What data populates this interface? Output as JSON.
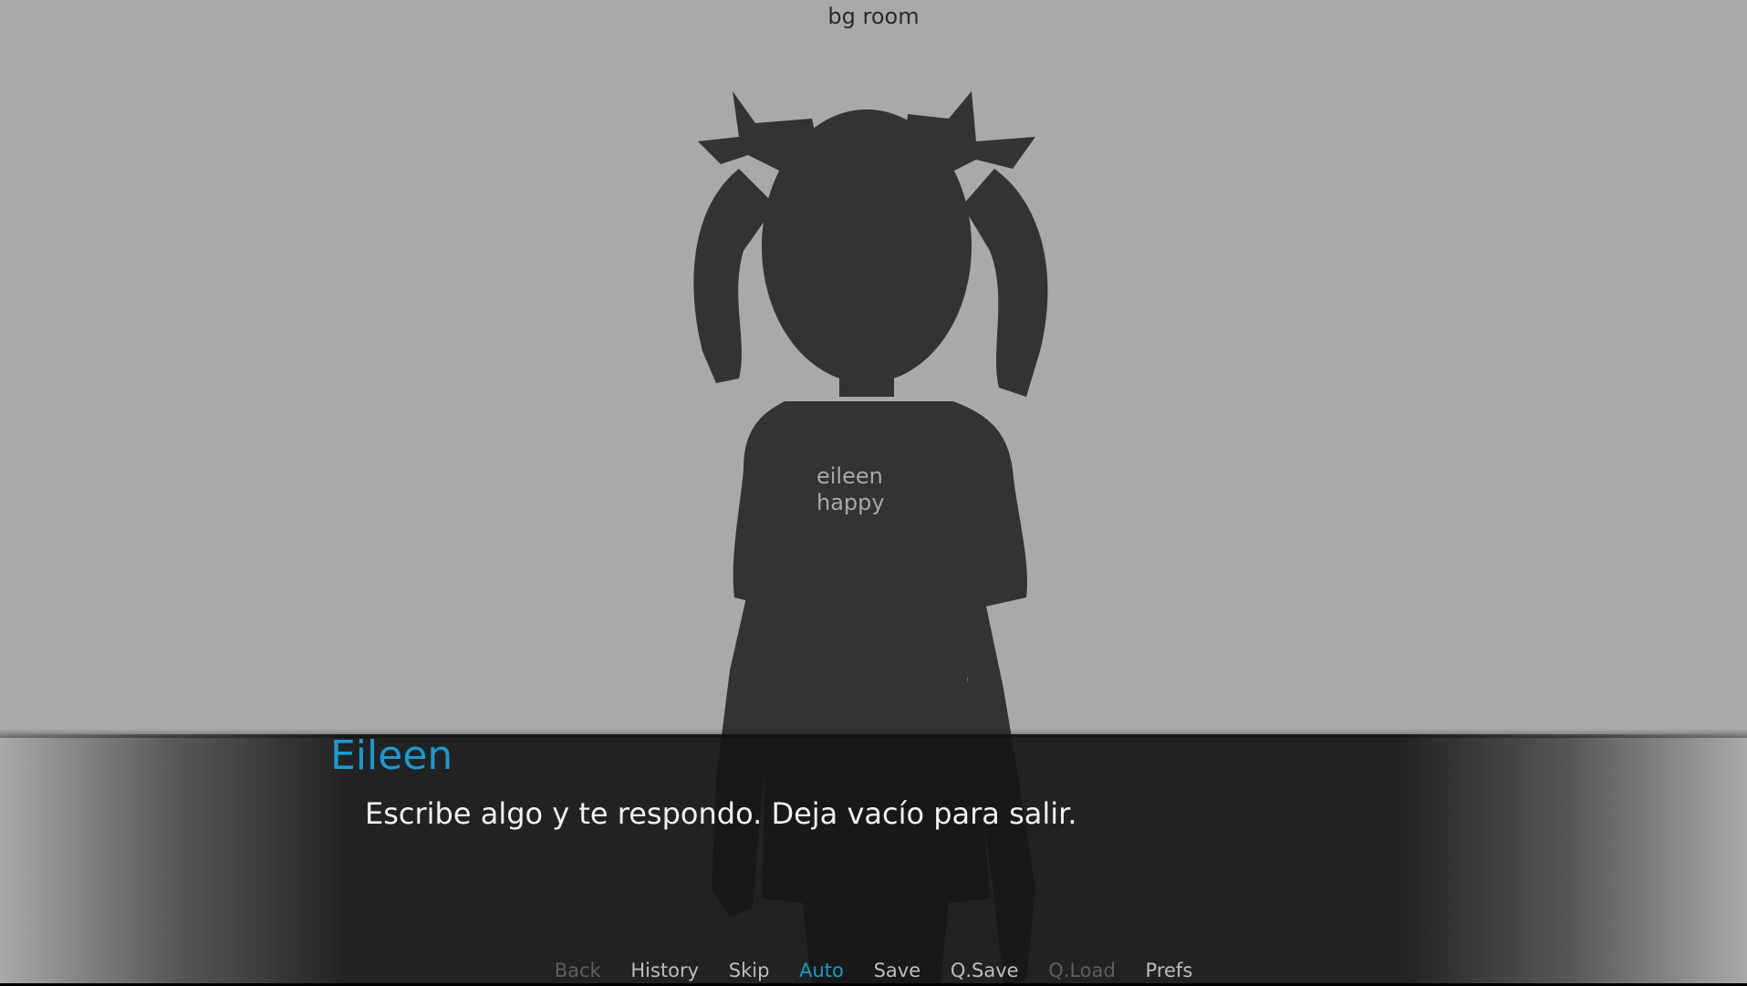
{
  "scene": {
    "background_label": "bg room"
  },
  "sprite": {
    "placeholder_line1": "eileen",
    "placeholder_line2": "happy"
  },
  "dialogue": {
    "speaker": "Eileen",
    "text": "Escribe algo y te respondo. Deja vacío para salir."
  },
  "quick_menu": {
    "back": "Back",
    "history": "History",
    "skip": "Skip",
    "auto": "Auto",
    "save": "Save",
    "qsave": "Q.Save",
    "qload": "Q.Load",
    "prefs": "Prefs"
  },
  "colors": {
    "accent": "#1b9ad0",
    "background": "#a9a9a9",
    "silhouette": "#333333"
  }
}
